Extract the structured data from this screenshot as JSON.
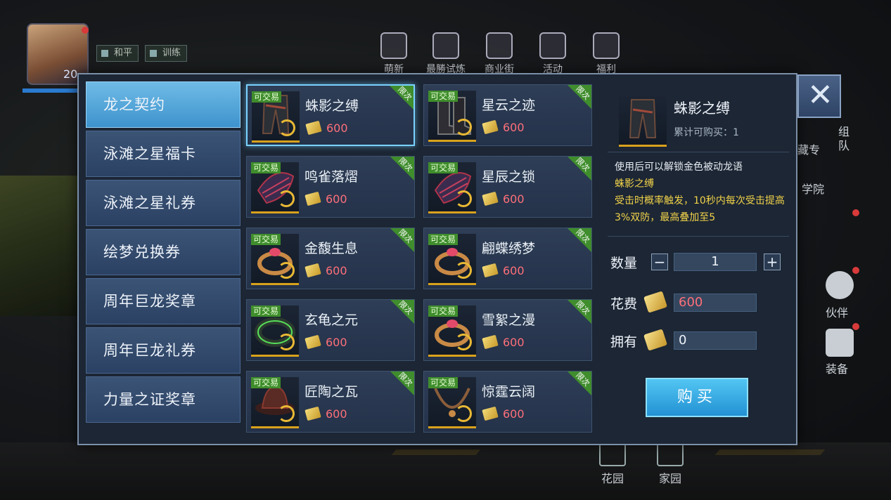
{
  "hud": {
    "level": "20",
    "chips": [
      "和平",
      "训练"
    ],
    "top_menu": [
      "萌新",
      "最勝试炼",
      "商业街",
      "活动",
      "福利"
    ],
    "side": {
      "partner": "伙伴",
      "equip": "装备",
      "group": "组队",
      "collect": "藏专",
      "academy": "学院"
    },
    "bottom": {
      "garden": "花园",
      "home": "家园"
    }
  },
  "categories": [
    {
      "label": "龙之契约",
      "active": true
    },
    {
      "label": "泳滩之星福卡",
      "active": false
    },
    {
      "label": "泳滩之星礼券",
      "active": false
    },
    {
      "label": "绘梦兑换券",
      "active": false
    },
    {
      "label": "周年巨龙奖章",
      "active": false
    },
    {
      "label": "周年巨龙礼券",
      "active": false
    },
    {
      "label": "力量之证奖章",
      "active": false
    }
  ],
  "items": [
    {
      "name": "蛛影之缚",
      "price": "600",
      "tag": "可交易",
      "limit": "限次",
      "icon": "pants-icon",
      "selected": true
    },
    {
      "name": "星云之迹",
      "price": "600",
      "tag": "可交易",
      "limit": "限次",
      "icon": "boots-icon",
      "selected": false
    },
    {
      "name": "鸣雀落熠",
      "price": "600",
      "tag": "可交易",
      "limit": "限次",
      "icon": "gloves-icon",
      "selected": false
    },
    {
      "name": "星辰之锁",
      "price": "600",
      "tag": "可交易",
      "limit": "限次",
      "icon": "gloves-icon",
      "selected": false
    },
    {
      "name": "金馥生息",
      "price": "600",
      "tag": "可交易",
      "limit": "限次",
      "icon": "ring-icon",
      "selected": false
    },
    {
      "name": "翩蝶绣梦",
      "price": "600",
      "tag": "可交易",
      "limit": "限次",
      "icon": "ring-icon",
      "selected": false
    },
    {
      "name": "玄龟之元",
      "price": "600",
      "tag": "可交易",
      "limit": "限次",
      "icon": "bracelet-icon",
      "selected": false
    },
    {
      "name": "雪絮之漫",
      "price": "600",
      "tag": "可交易",
      "limit": "限次",
      "icon": "ring-icon",
      "selected": false
    },
    {
      "name": "匠陶之瓦",
      "price": "600",
      "tag": "可交易",
      "limit": "限次",
      "icon": "hat-icon",
      "selected": false
    },
    {
      "name": "惊霆云阔",
      "price": "600",
      "tag": "可交易",
      "limit": "限次",
      "icon": "necklace-icon",
      "selected": false
    }
  ],
  "detail": {
    "title": "蛛影之缚",
    "purchasable": "累计可购买：1",
    "desc_1": "使用后可以解锁金色被动龙语",
    "desc_name": "蛛影之缚",
    "desc_2": "受击时概率触发，10秒内每次受击提高3%双防，最高叠加至5",
    "qty_label": "数量",
    "qty_value": "1",
    "cost_label": "花费",
    "cost_value": "600",
    "own_label": "拥有",
    "own_value": "0",
    "buy_label": "购买",
    "minus": "−",
    "plus": "+"
  },
  "colors": {
    "price": "#ff6f7a",
    "accent": "#3e93cd",
    "highlight": "#f2d34a",
    "tag": "#3f8d2c"
  }
}
